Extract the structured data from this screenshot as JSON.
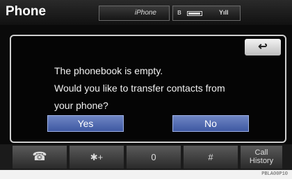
{
  "header": {
    "title": "Phone",
    "device_name": "iPhone",
    "bluetooth_icon": "ʙ",
    "signal_text": "Yıll"
  },
  "dialog": {
    "back_label": "↩",
    "lines": [
      "The phonebook is empty.",
      "Would you like to transfer contacts from",
      "your phone?"
    ],
    "yes_label": "Yes",
    "no_label": "No"
  },
  "keypad": {
    "handset_icon": "☎",
    "star_label": "✱+",
    "zero_label": "0",
    "hash_label": "#",
    "call_history_line1": "Call",
    "call_history_line2": "History"
  },
  "watermark": "",
  "footer_code": "PBLA00P10"
}
